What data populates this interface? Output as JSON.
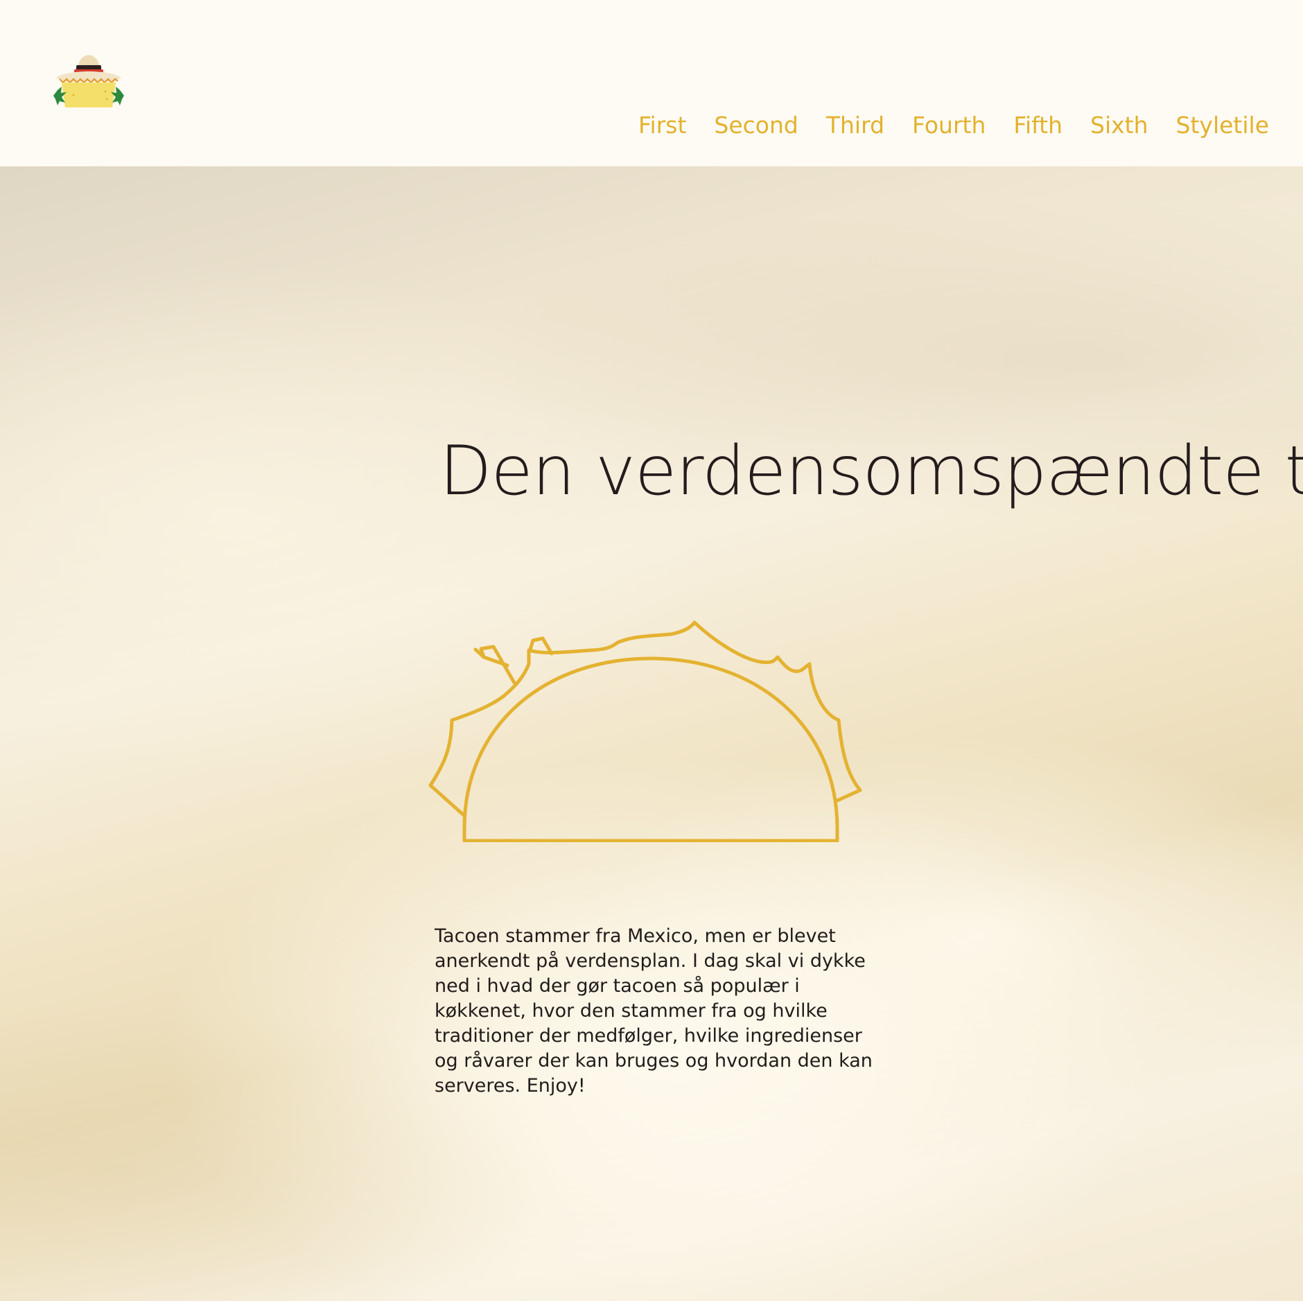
{
  "header": {
    "nav": [
      {
        "label": "First"
      },
      {
        "label": "Second"
      },
      {
        "label": "Third"
      },
      {
        "label": "Fourth"
      },
      {
        "label": "Fifth"
      },
      {
        "label": "Sixth"
      },
      {
        "label": "Styletile"
      }
    ]
  },
  "hero": {
    "title": "Den verdensomspændte taco",
    "text": "Tacoen stammer fra Mexico, men er blevet anerkendt på verdensplan. I dag skal vi dykke ned i hvad der gør tacoen så populær i køkkenet, hvor den stammer fra og hvilke traditioner der medfølger, hvilke ingredienser og råvarer der kan bruges og hvordan den kan serveres. Enjoy!"
  },
  "icons": {
    "logo": "sombrero-taco-icon",
    "illustration": "taco-outline-icon"
  },
  "colors": {
    "accent": "#e3b12e",
    "header_background": "#fdfbf3",
    "text_dark": "#241c1c"
  }
}
